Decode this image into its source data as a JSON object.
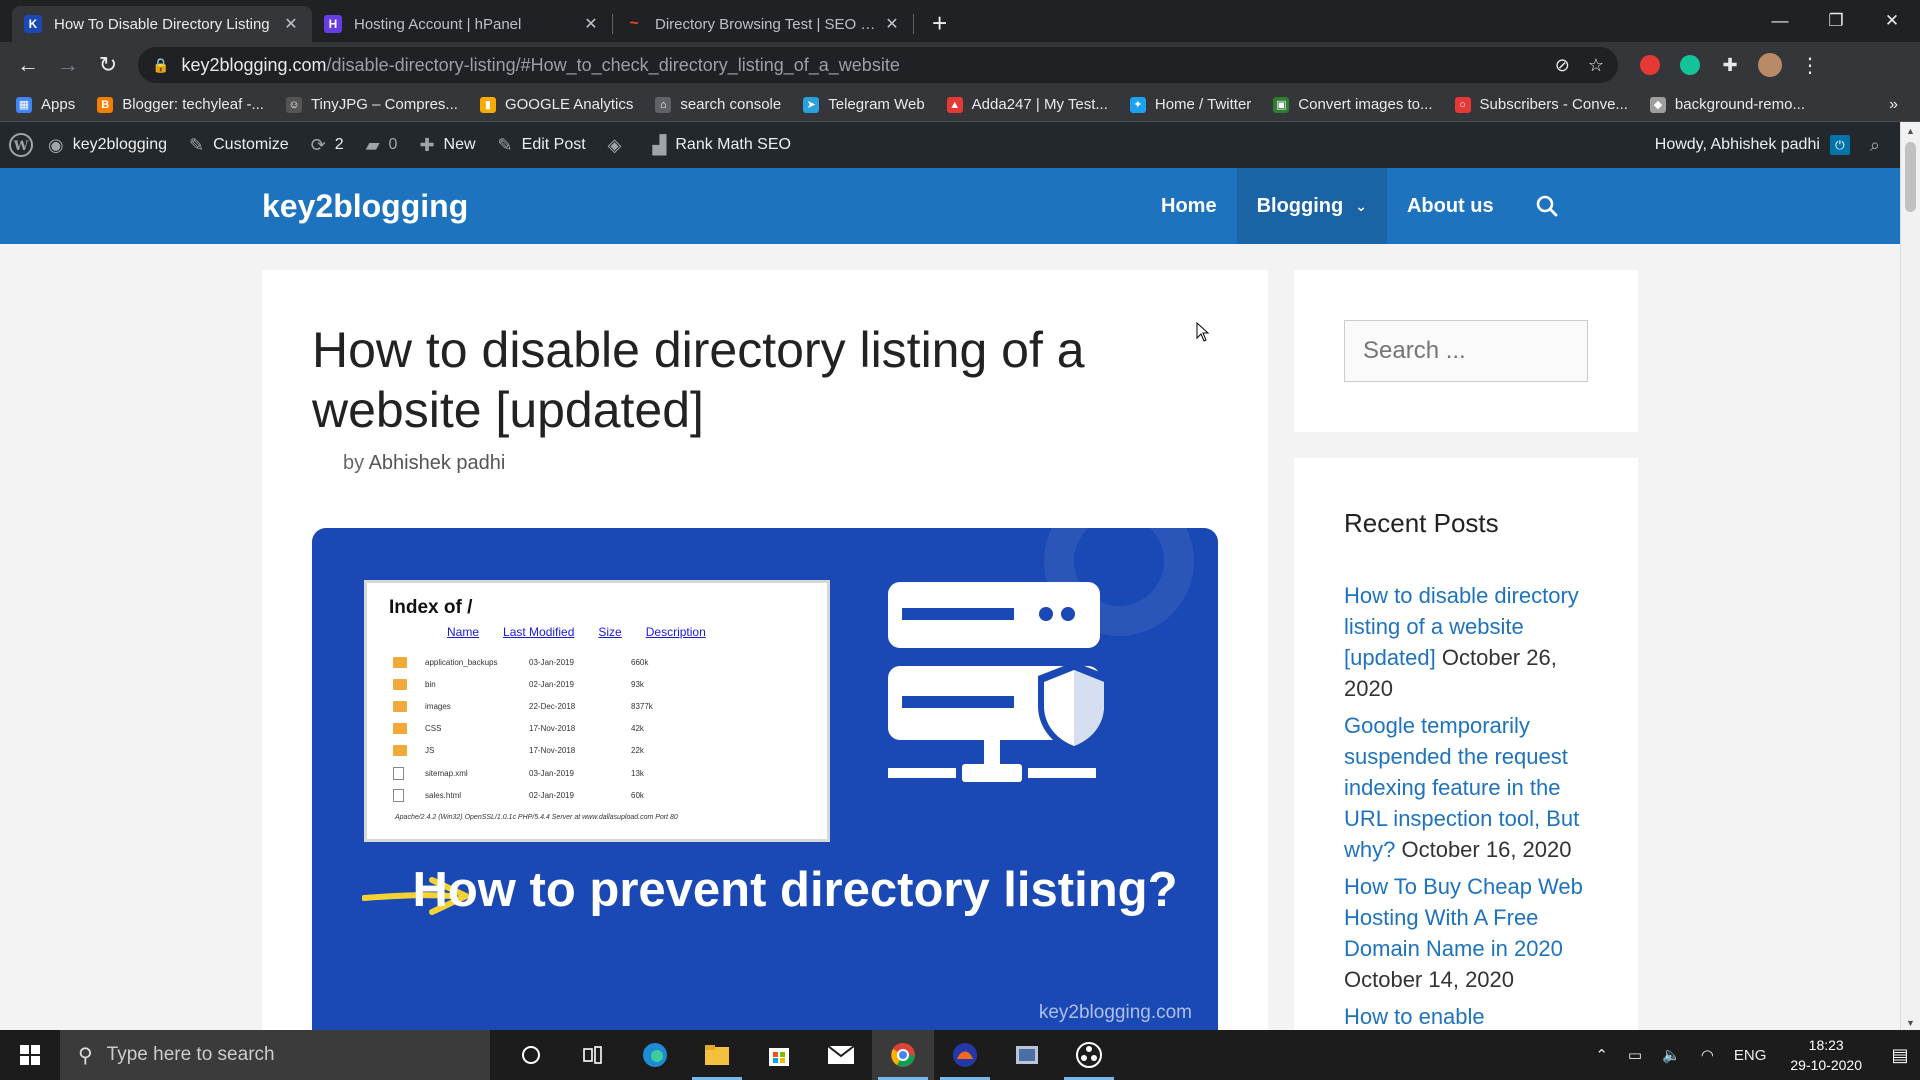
{
  "browser": {
    "tabs": [
      {
        "title": "How To Disable Directory Listing",
        "favicon": "K",
        "favicon_color": "#1a48b4",
        "active": true
      },
      {
        "title": "Hosting Account | hPanel",
        "favicon": "H",
        "favicon_color": "#673de6",
        "active": false
      },
      {
        "title": "Directory Browsing Test | SEO Site",
        "favicon": "~",
        "favicon_color": "#e8462b",
        "active": false
      }
    ],
    "url_host": "key2blogging.com",
    "url_path": "/disable-directory-listing/#How_to_check_directory_listing_of_a_website",
    "bookmarks": [
      {
        "label": "Apps",
        "color": "#4285f4",
        "glyph": "▦"
      },
      {
        "label": "Blogger: techyleaf -...",
        "color": "#f57d00",
        "glyph": "B"
      },
      {
        "label": "TinyJPG – Compres...",
        "color": "#555555",
        "glyph": "☺"
      },
      {
        "label": "GOOGLE Analytics",
        "color": "#f9ab00",
        "glyph": "▮"
      },
      {
        "label": "search console",
        "color": "#5f6368",
        "glyph": "⌂"
      },
      {
        "label": "Telegram Web",
        "color": "#2aa1da",
        "glyph": "➤"
      },
      {
        "label": "Adda247 | My Test...",
        "color": "#e53935",
        "glyph": "▲"
      },
      {
        "label": "Home / Twitter",
        "color": "#1da1f2",
        "glyph": "✦"
      },
      {
        "label": "Convert images to...",
        "color": "#2e7d32",
        "glyph": "▣"
      },
      {
        "label": "Subscribers - Conve...",
        "color": "#e53935",
        "glyph": "○"
      },
      {
        "label": "background-remo...",
        "color": "#9e9e9e",
        "glyph": "◆"
      }
    ]
  },
  "adminbar": {
    "site": "key2blogging",
    "customize": "Customize",
    "updates": "2",
    "comments": "0",
    "new": "New",
    "edit_post": "Edit Post",
    "rank_math": "Rank Math SEO",
    "howdy": "Howdy, Abhishek padhi"
  },
  "site": {
    "title": "key2blogging",
    "nav": {
      "home": "Home",
      "blogging": "Blogging",
      "about": "About us"
    }
  },
  "article": {
    "title": "How to disable directory listing of a website [updated]",
    "byline_prefix": "by",
    "author": "Abhishek padhi",
    "featured": {
      "index_title": "Index of /",
      "columns": [
        "Name",
        "Last Modified",
        "Size",
        "Description"
      ],
      "rows": [
        {
          "name": "application_backups",
          "date": "03-Jan-2019",
          "size": "660k",
          "type": "folder"
        },
        {
          "name": "bin",
          "date": "02-Jan-2019",
          "size": "93k",
          "type": "folder"
        },
        {
          "name": "images",
          "date": "22-Dec-2018",
          "size": "8377k",
          "type": "folder"
        },
        {
          "name": "CSS",
          "date": "17-Nov-2018",
          "size": "42k",
          "type": "folder"
        },
        {
          "name": "JS",
          "date": "17-Nov-2018",
          "size": "22k",
          "type": "folder"
        },
        {
          "name": "sitemap.xml",
          "date": "03-Jan-2019",
          "size": "13k",
          "type": "file"
        },
        {
          "name": "sales.html",
          "date": "02-Jan-2019",
          "size": "60k",
          "type": "file"
        }
      ],
      "footer": "Apache/2.4.2 (Win32) OpenSSL/1.0.1c PHP/5.4.4 Server at www.dallasupload.com Port 80",
      "headline": "How to prevent directory listing?",
      "domain": "key2blogging.com"
    }
  },
  "sidebar": {
    "search_placeholder": "Search ...",
    "recent_title": "Recent Posts",
    "recent_posts": [
      {
        "title": "How to disable directory listing of a website [updated]",
        "date": "October 26, 2020"
      },
      {
        "title": "Google temporarily suspended the request indexing feature in the URL inspection tool, But why?",
        "date": "October 16, 2020"
      },
      {
        "title": "How To Buy Cheap Web Hosting With A Free Domain Name in 2020",
        "date": "October 14, 2020"
      },
      {
        "title": "How to enable",
        "date": ""
      }
    ]
  },
  "taskbar": {
    "search_placeholder": "Type here to search",
    "lang": "ENG",
    "time": "18:23",
    "date": "29-10-2020"
  },
  "colors": {
    "header_blue": "#1e73be",
    "featured_blue": "#1a48b4",
    "link_blue": "#1e73be"
  }
}
